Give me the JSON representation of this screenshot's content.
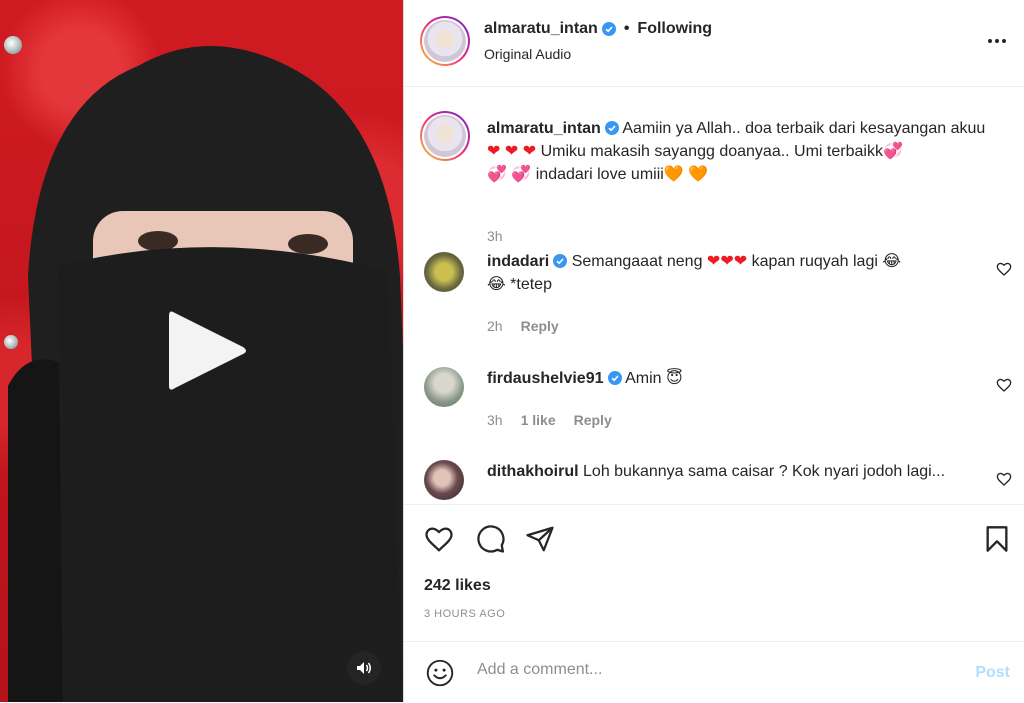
{
  "post": {
    "author": "almaratu_intan",
    "following_label": "Following",
    "separator": "•",
    "audio_label": "Original Audio",
    "more_label": "•••"
  },
  "caption": {
    "username": "almaratu_intan",
    "text_parts": [
      "Aamiin ya Allah.. doa terbaik dari kesayangan",
      "akuu",
      "Umiku makasih sayangg doanyaa.. Umi terbaikk",
      "indadari love umiii"
    ],
    "time": "3h"
  },
  "comments": [
    {
      "username": "indadari",
      "text_a": "Semangaaat neng",
      "text_b": "kapan ruqyah lagi",
      "text_c": "*tetep",
      "time": "2h",
      "reply": "Reply"
    },
    {
      "username": "firdaushelvie91",
      "text_a": "Amin",
      "time": "3h",
      "likes": "1 like",
      "reply": "Reply"
    },
    {
      "username": "dithakhoirul",
      "text_a": "Loh bukannya sama caisar ? Kok nyari jodoh lagi..."
    }
  ],
  "stats": {
    "likes": "242 likes",
    "time": "3 HOURS AGO"
  },
  "add_comment": {
    "placeholder": "Add a comment...",
    "post_label": "Post"
  },
  "emoji": {
    "heart": "❤",
    "laugh": "😂",
    "smile": "😇",
    "orange_heart": "🧡",
    "love": "💞"
  },
  "colors": {
    "accent": "#0095f6",
    "verified": "#3897f0",
    "post_disabled": "#b2dffc",
    "muted": "#8e8e8e"
  }
}
